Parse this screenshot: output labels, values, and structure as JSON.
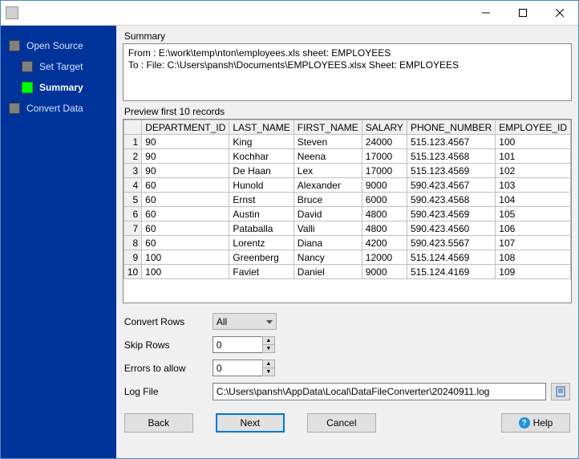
{
  "sidebar": {
    "items": [
      {
        "label": "Open Source",
        "active": false,
        "child": false
      },
      {
        "label": "Set Target",
        "active": false,
        "child": true
      },
      {
        "label": "Summary",
        "active": true,
        "child": true
      },
      {
        "label": "Convert Data",
        "active": false,
        "child": false
      }
    ]
  },
  "summary": {
    "title": "Summary",
    "line1": "From : E:\\work\\temp\\nton\\employees.xls sheet: EMPLOYEES",
    "line2": "To : File: C:\\Users\\pansh\\Documents\\EMPLOYEES.xlsx Sheet: EMPLOYEES"
  },
  "preview": {
    "title": "Preview first 10 records",
    "columns": [
      "DEPARTMENT_ID",
      "LAST_NAME",
      "FIRST_NAME",
      "SALARY",
      "PHONE_NUMBER",
      "EMPLOYEE_ID"
    ],
    "rows": [
      [
        "90",
        "King",
        "Steven",
        "24000",
        "515.123.4567",
        "100"
      ],
      [
        "90",
        "Kochhar",
        "Neena",
        "17000",
        "515.123.4568",
        "101"
      ],
      [
        "90",
        "De Haan",
        "Lex",
        "17000",
        "515.123.4569",
        "102"
      ],
      [
        "60",
        "Hunold",
        "Alexander",
        "9000",
        "590.423.4567",
        "103"
      ],
      [
        "60",
        "Ernst",
        "Bruce",
        "6000",
        "590.423.4568",
        "104"
      ],
      [
        "60",
        "Austin",
        "David",
        "4800",
        "590.423.4569",
        "105"
      ],
      [
        "60",
        "Pataballa",
        "Valli",
        "4800",
        "590.423.4560",
        "106"
      ],
      [
        "60",
        "Lorentz",
        "Diana",
        "4200",
        "590.423.5567",
        "107"
      ],
      [
        "100",
        "Greenberg",
        "Nancy",
        "12000",
        "515.124.4569",
        "108"
      ],
      [
        "100",
        "Faviet",
        "Daniel",
        "9000",
        "515.124.4169",
        "109"
      ]
    ]
  },
  "controls": {
    "convert_rows": {
      "label": "Convert Rows",
      "value": "All"
    },
    "skip_rows": {
      "label": "Skip Rows",
      "value": "0"
    },
    "errors_allow": {
      "label": "Errors to allow",
      "value": "0"
    },
    "log_file": {
      "label": "Log File",
      "value": "C:\\Users\\pansh\\AppData\\Local\\DataFileConverter\\20240911.log"
    }
  },
  "buttons": {
    "back": "Back",
    "next": "Next",
    "cancel": "Cancel",
    "help": "Help"
  }
}
